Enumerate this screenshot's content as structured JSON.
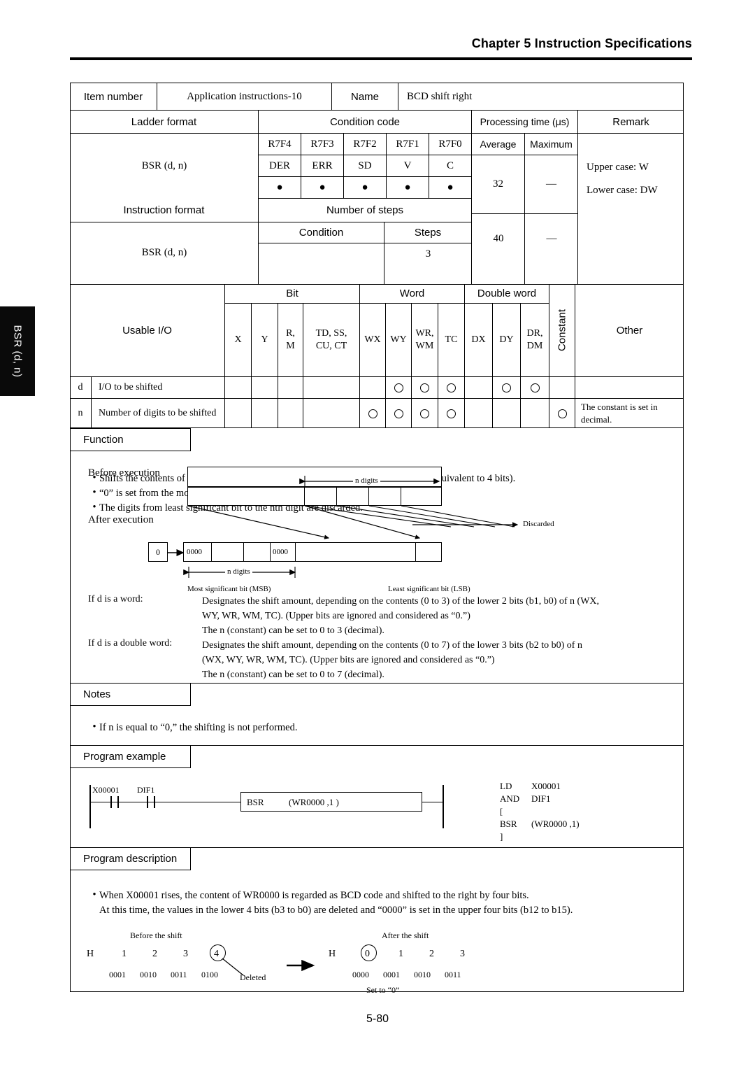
{
  "header": {
    "chapter": "Chapter 5  Instruction Specifications"
  },
  "side_tab": {
    "label": "BSR (d, n)"
  },
  "page_number": "5-80",
  "spec_table": {
    "item_number_label": "Item number",
    "item_number_value": "Application instructions-10",
    "name_label": "Name",
    "name_value": "BCD shift right",
    "ladder_format_label": "Ladder format",
    "condition_code_label": "Condition code",
    "processing_time_label": "Processing time (μs)",
    "remark_label": "Remark",
    "ladder_format_value": "BSR (d, n)",
    "condition_code_registers": [
      "R7F4",
      "R7F3",
      "R7F2",
      "R7F1",
      "R7F0"
    ],
    "condition_code_flags": [
      "DER",
      "ERR",
      "SD",
      "V",
      "C"
    ],
    "condition_code_marks": [
      "●",
      "●",
      "●",
      "●",
      "●"
    ],
    "average_label": "Average",
    "maximum_label": "Maximum",
    "average_value_1": "32",
    "maximum_value_1": "—",
    "remark_line_1": "Upper case: W",
    "remark_line_2": "Lower case: DW",
    "instruction_format_label": "Instruction format",
    "number_of_steps_label": "Number of steps",
    "condition_label": "Condition",
    "steps_label": "Steps",
    "instruction_format_value": "BSR (d, n)",
    "condition_value": "",
    "steps_value": "3",
    "average_value_2": "40",
    "maximum_value_2": "—"
  },
  "usable_io": {
    "title": "Usable I/O",
    "group_bit": "Bit",
    "group_word": "Word",
    "group_double_word": "Double word",
    "constant_label": "Constant",
    "other_label": "Other",
    "columns": [
      {
        "top": "",
        "bottom": "X"
      },
      {
        "top": "",
        "bottom": "Y"
      },
      {
        "top": "R,",
        "bottom": "M"
      },
      {
        "top": "TD, SS,",
        "bottom": "CU, CT"
      },
      {
        "top": "",
        "bottom": "WX"
      },
      {
        "top": "",
        "bottom": "WY"
      },
      {
        "top": "WR,",
        "bottom": "WM"
      },
      {
        "top": "",
        "bottom": "TC"
      },
      {
        "top": "",
        "bottom": "DX"
      },
      {
        "top": "",
        "bottom": "DY"
      },
      {
        "top": "DR,",
        "bottom": "DM"
      }
    ],
    "rows": [
      {
        "key": "d",
        "description": "I/O to be shifted",
        "marks": [
          false,
          false,
          false,
          false,
          false,
          true,
          true,
          true,
          false,
          true,
          true
        ],
        "constant": false,
        "other": ""
      },
      {
        "key": "n",
        "description": "Number of digits to be shifted",
        "marks": [
          false,
          false,
          false,
          false,
          true,
          true,
          true,
          true,
          false,
          false,
          false
        ],
        "constant": true,
        "other": "The constant is set in decimal."
      }
    ]
  },
  "function": {
    "title": "Function",
    "bullets": [
      "Shifts the contents of d to the right (toward the lower digits) by n digits (1 digit is equivalent to 4 bits).",
      "“0” is set from the most significant bit to the nth digit.",
      "The digits from least significant bit to the nth digit are discarded."
    ],
    "diagram": {
      "before_label": "Before execution",
      "after_label": "After execution",
      "n_digits_top": "n digits",
      "n_digits_bottom": "n digits",
      "discarded_label": "Discarded",
      "zero_input": "0",
      "zeros_left": "0000",
      "zeros_right": "0000",
      "msb_label": "Most significant bit (MSB)",
      "lsb_label": "Least significant bit (LSB)"
    },
    "notes_word": {
      "label": "If d is a word:",
      "lines": [
        "Designates the shift amount, depending on the contents (0 to 3) of the lower 2 bits (b1, b0) of n (WX,",
        "WY, WR, WM, TC).  (Upper bits are ignored and considered as “0.”)",
        "The n (constant) can be set to 0 to 3 (decimal)."
      ]
    },
    "notes_double_word": {
      "label": "If d is a double word:",
      "lines": [
        "Designates the shift amount, depending on the contents (0 to 7) of the lower 3 bits (b2 to b0) of n",
        "(WX, WY, WR, WM, TC).  (Upper bits are ignored and considered as “0.”)",
        "The n (constant) can be set to 0 to 7 (decimal)."
      ]
    }
  },
  "notes": {
    "title": "Notes",
    "bullets": [
      "If n is equal to “0,” the shifting is not performed."
    ]
  },
  "program_example": {
    "title": "Program example",
    "ladder": {
      "contact_1": "X00001",
      "contact_2": "DIF1",
      "box_instruction": "BSR",
      "box_operand": "(WR0000 ,1  )"
    },
    "mnemonics": [
      {
        "op": "LD",
        "arg": "X00001"
      },
      {
        "op": "AND",
        "arg": "DIF1"
      },
      {
        "op": "[",
        "arg": ""
      },
      {
        "op": "BSR",
        "arg": "(WR0000 ,1)"
      },
      {
        "op": "]",
        "arg": ""
      }
    ]
  },
  "program_description": {
    "title": "Program description",
    "bullets": [
      "When X00001 rises, the content of WR0000 is regarded as BCD code and shifted to the right by four bits.",
      "At this time, the values in the lower 4 bits (b3 to b0) are deleted and “0000” is set in the upper four bits (b12 to b15)."
    ],
    "before": {
      "caption": "Before the shift",
      "prefix": "H",
      "digits": [
        "1",
        "2",
        "3",
        "4"
      ],
      "binaries": [
        "0001",
        "0010",
        "0011",
        "0100"
      ],
      "annotation": "Deleted"
    },
    "after": {
      "caption": "After the shift",
      "prefix": "H",
      "digits": [
        "0",
        "1",
        "2",
        "3"
      ],
      "binaries": [
        "0000",
        "0001",
        "0010",
        "0011"
      ],
      "annotation": "Set to “0”"
    }
  }
}
